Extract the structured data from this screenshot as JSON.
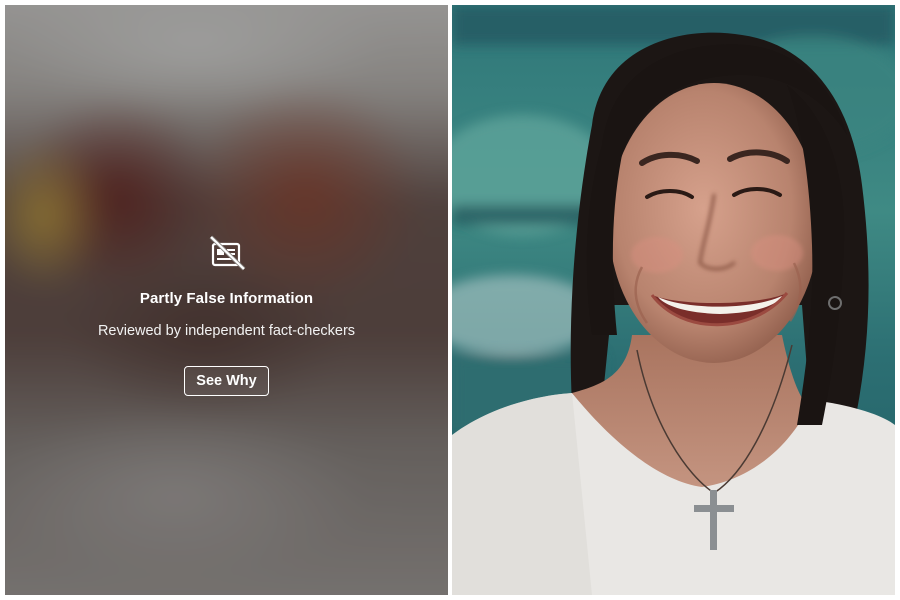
{
  "fact_check_overlay": {
    "icon": "no-news-icon",
    "title": "Partly False Information",
    "subtitle": "Reviewed by independent fact-checkers",
    "button_label": "See Why"
  },
  "photo": {
    "subject": "smiling woman with dark hair and cross necklace"
  },
  "colors": {
    "overlay_text": "#ffffff",
    "background_teal": "#2a6f74",
    "frame_border": "#ffffff"
  }
}
